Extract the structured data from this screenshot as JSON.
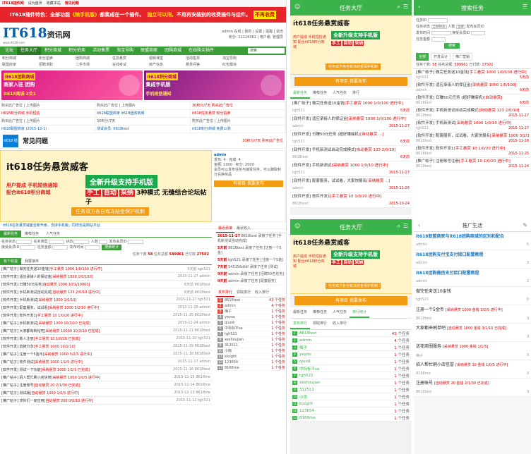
{
  "desktop": {
    "topbar": {
      "brand": "IT618插件网",
      "links": [
        "设为首页",
        "收藏本站",
        "常见问题"
      ]
    },
    "redbar": {
      "text1": "IT618插件特色：全部功能",
      "hl1": "(除手机版)",
      "text2": "都集成在一个插件。",
      "hl2": "独立可以用,",
      "text3": "不用再安装别的收费插件与组件。",
      "tag": "不再收费"
    },
    "logo": {
      "name": "IT618",
      "suffix": "资讯网",
      "url": "www.it618.com"
    },
    "userbox": {
      "line1": "admin 在线 | 我的 | 设置 | 提醒 | 退出",
      "line2": "积分: 11124361 | 用户组: 管理员"
    },
    "nav": [
      "论坛",
      "任务大厅",
      "积分商城",
      "积分拍卖",
      "活动售票",
      "淘宝导购",
      "联盟商家",
      "团购商城",
      "在线购买插件"
    ],
    "nav_active": 1,
    "nav_search": "搜索",
    "subnav": [
      "积分商城",
      "积分拍卖",
      "团购商城",
      "任务悬赏",
      "视频课堂",
      "活动售票",
      "淘宝导购",
      "联盟商家",
      "招聘求职",
      "二手市场",
      "在线考试",
      "房产信息",
      "悬赏问答",
      "红包模块"
    ],
    "banners": [
      {
        "tag": "it618团购商城",
        "title": "商家入驻 团购",
        "sub": "it618商城 2合1"
      },
      {
        "tag": "it618积分商城",
        "title": "集成手机版",
        "sub": "手机短信通知"
      }
    ],
    "adgrid": [
      {
        "text": "购买此广告位 | 上传图片",
        "cls": ""
      },
      {
        "text": "购买此广告位 | 上传图片",
        "cls": ""
      },
      {
        "text": "30积分/7天 购买此广告位",
        "cls": "r"
      },
      {
        "text": "it618积分商城 手机短信",
        "cls": "r"
      },
      {
        "text": "it618联盟商家 it618团购商城",
        "cls": "b"
      },
      {
        "text": "it618任务悬赏 积分拍卖",
        "cls": "r"
      },
      {
        "text": "购买此广告位 | 上传图片",
        "cls": ""
      },
      {
        "text": "30积分/7天",
        "cls": ""
      },
      {
        "text": "购买此广告位 | 上传图片",
        "cls": ""
      },
      {
        "text": "it618联盟商家 (2015-12-1)",
        "cls": "b"
      },
      {
        "text": "测试会员: it618test",
        "cls": "b"
      },
      {
        "text": "it618积分商城 免费公测",
        "cls": "b"
      }
    ],
    "faq": {
      "icon": "it618 插件",
      "title": "常见问题",
      "note": "30积分/7天 购买此广告位"
    },
    "hero": {
      "t1": "it618任务悬赏威客",
      "t2": "全新升级支持手机版",
      "t3a": "手工",
      "t3b": "自动",
      "t3c": "采纳",
      "t3d": "3种模式 无缝结合论坛帖子",
      "t4": "用户提成 手机短信通知 配合it618积分商城",
      "t5": "任务双方各自有冻结金保护机制"
    },
    "profile": {
      "name": "admin",
      "line1": "发布: 4  · 完成: 4",
      "line2": "金额: 1000 · 积分: 2000",
      "line3": "会员可以发布任务与接受任务，可以赚取积分兑换奖品",
      "btn": "有项目 我要发布"
    },
    "ticker": "it618任务悬赏威客全新升级，支持手机版，同样也是网站平台",
    "tabs": [
      "最新任务",
      "推荐任务",
      "人气任务"
    ],
    "filter": {
      "l1": "任务状态",
      "l2": "任务类型",
      "l3": "状态",
      "l4": "人数",
      "l5": "发布会员ID",
      "l6": "接受会员ID",
      "l7": "任务金额",
      "l8": "发布时间",
      "go": "搜索统计"
    },
    "counter": {
      "a": "任务个数",
      "b": "58",
      "c": "任务总额",
      "d": "589961",
      "e": "已付款",
      "f": "27502"
    },
    "tabs2": [
      "有个收益",
      "我要接单"
    ],
    "tasks": [
      {
        "t": "[推广帖子] 做完任务送10金钱",
        "e": "[手工悬赏 1000 1/0/100 进行中]",
        "r": "5天前 tgh521"
      },
      {
        "t": "[软件开发] 适应承接人的保证金",
        "e": "[采纳悬赏 1000 1/0/100]",
        "r": "2015-11-27 admin"
      },
      {
        "t": "[软件开发] 日赚50元任务",
        "e": "[自动悬赏 1000 10/1/10000]",
        "r": "6天前 8618test"
      },
      {
        "t": "[软件开发] 手机新测试自动完成",
        "e": "[自动悬赏 123 2/0/10 进行中]",
        "r": "6天前 8618test"
      },
      {
        "t": "[软件开发] 手机新测试",
        "e": "[采纳悬赏 1000 1/0/10]",
        "r": "2015-11-27 tgh521"
      },
      {
        "t": "[软件开发] 配套服务，试试看",
        "e": "[采纳悬赏 1000 3/2/10 进行中]",
        "r": "2015-11-26 admin"
      },
      {
        "t": "[软件开发] 软件开发1",
        "e": "[手工悬赏 10 1/0/20 进行中]",
        "r": "2015-11-25 8618test"
      },
      {
        "t": "[推广帖子] 手机新测试",
        "e": "[采纳悬赏 1000 10/3/10 已完成]",
        "r": "2015-11-24 admin"
      },
      {
        "t": "[推广帖子] 大家都有新帖吧",
        "e": "[采纳悬赏 10000 10/3/10 已完成]",
        "r": "2015-11-21 8618test"
      },
      {
        "t": "[软件开发] 新人注册",
        "e": "[手工悬赏 10 1/0/20 已完成]",
        "r": "2015-11-20 tgh521"
      },
      {
        "t": "[软件开发] 直链分享",
        "e": "[手工悬赏 1000 10/1/10]",
        "r": "2015-11-19 8618test"
      },
      {
        "t": "[推广帖子] 注册一个5金币",
        "e": "[采纳悬赏 1000 3/2/5 进行中]",
        "r": "2015-11-18 8618test"
      },
      {
        "t": "[推广帖子] 软件测试",
        "e": "[采纳悬赏 1000 1/1/5 进行中]",
        "r": "2015-11-17 admin"
      },
      {
        "t": "[软件开发] 测试一下功能",
        "e": "[采纳悬赏 1000 1/1/1 已完成]",
        "r": "2015-11-16 8618test"
      },
      {
        "t": "[推广帖子] 招人帮忙刷小店信誉",
        "e": "[采纳悬赏 1000 1/0/5 进行中]",
        "r": "2015-11-15 8618me"
      },
      {
        "t": "[推广帖子] 注册账号",
        "e": "[自动悬赏 20 2/1/30 已完成]",
        "r": "2015-11-14 8618me"
      },
      {
        "t": "[推广帖子] 测试版",
        "e": "[自动悬赏 1000 1/0/5 进行中]",
        "r": "2015-11-13 8618me"
      },
      {
        "t": "[推广帖子] 求你们一家应用",
        "e": "[自动悬赏 200 0/0/10 进行中]",
        "r": "2015-11-12 tgh521"
      }
    ],
    "sidebar": {
      "tabs": [
        "最近承接",
        "最近收入"
      ],
      "news": [
        {
          "d": "2015-11-27",
          "t": "8618test 承接了任务 [手机新测试自动完成]"
        },
        {
          "d": "5天前",
          "t": "8618test 承接了任务 [注册一个5金]"
        },
        {
          "d": "5天前",
          "t": "tgh521 承接了任务 [注册一个5金]"
        },
        {
          "d": "7天前",
          "t": "545156dfdf 承接了任务 [测试]"
        },
        {
          "d": "9天前",
          "t": "admin 承接了任务 [招聘50名任务]"
        },
        {
          "d": "9天前",
          "t": "admin 承接了任务 [配套服务]"
        }
      ],
      "rtabs": [
        "发布排行",
        "领取排行",
        "收入排行"
      ],
      "ranks": [
        {
          "n": "1",
          "name": "8618test",
          "c": "43 个任务"
        },
        {
          "n": "2",
          "name": "admin",
          "c": "4 个任务"
        },
        {
          "n": "3",
          "name": "梅子",
          "c": "1 个任务"
        },
        {
          "n": "4",
          "name": "yeyou",
          "c": "1 个任务"
        },
        {
          "n": "5",
          "name": "qiuo9",
          "c": "1 个任务"
        },
        {
          "n": "6",
          "name": "中标标平se",
          "c": "1 个任务"
        },
        {
          "n": "7",
          "name": "tgh521",
          "c": "1 个任务"
        },
        {
          "n": "8",
          "name": "xeshoujian",
          "c": "1 个任务"
        },
        {
          "n": "9",
          "name": "312511",
          "c": "1 个任务"
        },
        {
          "n": "10",
          "name": "小雨",
          "c": "1 个任务"
        },
        {
          "n": "11",
          "name": "kloight",
          "c": "1 个任务"
        },
        {
          "n": "12",
          "name": "123654",
          "c": "1 个任务"
        },
        {
          "n": "13",
          "name": "8168me",
          "c": "1 个任务"
        }
      ]
    }
  },
  "mob1": {
    "title": "任务大厅",
    "btn": "有项目 我要发布",
    "tabs": [
      "最新任务",
      "推荐任务",
      "人气任务",
      "排行"
    ],
    "tasks": [
      {
        "t": "[推广帖子] 做完任务送10金钱",
        "e": "[手工悬赏 1000 1/0/100 进行中]",
        "u": "tgh521",
        "r": "5天前"
      },
      {
        "t": "[软件开发] 适应承接人的保证金",
        "e": "[采纳悬赏 1000 1/0/100 进行中]",
        "u": "admin",
        "r": "2015-11-27"
      },
      {
        "t": "[软件开发] 日赚50元任务 (超好赚接机)",
        "e": "[自动悬赏 ...]",
        "u": "tgh521",
        "r": "6天前"
      },
      {
        "t": "[软件开发] 手机新测试自动完成模式",
        "e": "[自动悬赏 123 2/0/10]",
        "u": "8618test",
        "r": "6天前"
      },
      {
        "t": "[软件开发] 手机新测试",
        "e": "[采纳悬赏 1000 1/0/10 进行中]",
        "u": "tgh521",
        "r": "2015-11-27"
      },
      {
        "t": "[软件开发] 配套服务，试试看，大家快报名",
        "e": "[采纳悬赏 ...]",
        "u": "admin",
        "r": "2015-11-26"
      },
      {
        "t": "[软件开发] 软件开发1",
        "e": "[手工悬赏 10 1/0/20 进行中]",
        "u": "8618test",
        "r": "2015-10-24"
      }
    ]
  },
  "mob3": {
    "title": "任务大厅",
    "btn": "有项目 我要发布",
    "tabs": [
      "最新任务",
      "推荐任务",
      "人气任务",
      "排行统计"
    ],
    "rtabs": [
      "发布排行",
      "领取排行",
      "收入排行"
    ],
    "ranks": [
      {
        "n": "1",
        "name": "8618test",
        "c": "43",
        "u": "个任务"
      },
      {
        "n": "2",
        "name": "admin",
        "c": "4",
        "u": "个任务"
      },
      {
        "n": "3",
        "name": "梅子",
        "c": "1",
        "u": "个任务"
      },
      {
        "n": "4",
        "name": "yeyou",
        "c": "1",
        "u": "个任务"
      },
      {
        "n": "5",
        "name": "qiuo9",
        "c": "1",
        "u": "个任务"
      },
      {
        "n": "6",
        "name": "中标标平se",
        "c": "1",
        "u": "个任务"
      },
      {
        "n": "7",
        "name": "tgh521",
        "c": "1",
        "u": "个任务"
      },
      {
        "n": "8",
        "name": "xeshoujian",
        "c": "1",
        "u": "个任务"
      },
      {
        "n": "9",
        "name": "312511",
        "c": "1",
        "u": "个任务"
      },
      {
        "n": "10",
        "name": "小雨",
        "c": "1",
        "u": "个任务"
      },
      {
        "n": "11",
        "name": "kloight",
        "c": "1",
        "u": "个任务"
      },
      {
        "n": "12",
        "name": "123654",
        "c": "1",
        "u": "个任务"
      },
      {
        "n": "13",
        "name": "8168me",
        "c": "1",
        "u": "个任务"
      }
    ]
  },
  "mob2": {
    "title": "搜索任务",
    "form": {
      "l1": "任务ID",
      "l2": "任务状态",
      "s1": "全部状态",
      "l3": "人数",
      "s2": "全部",
      "l4": "发布会员ID",
      "l5": "发布时间",
      "l6": "接受会员ID",
      "l7": "任务金额",
      "go": "搜索"
    },
    "tabs": [
      "全部",
      "开发设计",
      "推广营销"
    ],
    "count": {
      "a": "任务个数:",
      "b": "58",
      "c": "任务总额:",
      "d": "589961",
      "e": "已付款:",
      "f": "27502"
    },
    "tasks": [
      {
        "t": "[推广帖子] 做完任务送10金钱",
        "e": "[手工悬赏 1000 1/0/100 进行中]",
        "u": "tgh521",
        "r": "5天前"
      },
      {
        "t": "[软件开发] 适应承接人的保证金",
        "e": "[采纳悬赏 1000 1/0/100]",
        "u": "admin",
        "r": "6天前"
      },
      {
        "t": "[软件开发] 日赚50元任务 (超好赚接机)",
        "e": "[自动悬赏]",
        "u": "8618test",
        "r": "6天前"
      },
      {
        "t": "[软件开发] 手机新测试自动完成模式",
        "e": "[自动悬赏 123 2/0/10]",
        "u": "8618test",
        "r": "2015-11-27"
      },
      {
        "t": "[软件开发] 手机新测试",
        "e": "[采纳悬赏 1000 1/0/10 进行中]",
        "u": "tgh521",
        "r": "2015-11-27"
      },
      {
        "t": "[软件开发] 配套服务，试试看，大家快报名",
        "e": "[采纳悬赏 1000 3/2/10]",
        "u": "8618test",
        "r": "2015-11-26"
      },
      {
        "t": "[软件开发] 软件开发1",
        "e": "[手工悬赏 10 1/0/20 进行中]",
        "u": "8618test",
        "r": "2015-11-25"
      },
      {
        "t": "[推广帖子] 注册账号注册",
        "e": "[手工悬赏 10 1/0/20 进行中]",
        "u": "8618test",
        "r": "2015-11-24"
      }
    ]
  },
  "mob4": {
    "title": "推广生活",
    "items": [
      {
        "t": "it618联盟商家与it618团购商城的区别和配合",
        "hot": true,
        "e": "",
        "u": "admin",
        "r": "5"
      },
      {
        "t": "it618团购支付宝支付接口配置教程",
        "hot": true,
        "e": "",
        "u": "admin",
        "r": "3"
      },
      {
        "t": "it618团购微信支付接口配置教程",
        "hot": true,
        "e": "",
        "u": "admin",
        "r": "2"
      },
      {
        "t": "做完任务送10金钱",
        "hot": false,
        "e": "",
        "u": "tgh521",
        "r": "0"
      },
      {
        "t": "注册一个5金币",
        "hot": false,
        "e": "[采纳悬赏 1000 金钱 3/2/5 进行中]",
        "u": "8618test",
        "r": "0"
      },
      {
        "t": "大家都来刷单吧",
        "hot": false,
        "e": "[自动悬赏 1000 金钱 3/1/10 已完成]",
        "u": "",
        "r": "0"
      },
      {
        "t": "送花商圈服务",
        "hot": false,
        "e": "[采纳悬赏 1000 金钱 1/1/5]",
        "u": "梅子",
        "r": "0"
      },
      {
        "t": "招人帮忙刷小店信誉",
        "hot": false,
        "e": "[采纳悬赏 10 金钱 1/0/5 进行中]",
        "u": "8168me",
        "r": "0"
      },
      {
        "t": "注册账号",
        "hot": false,
        "e": "[自动悬赏 20 金钱 2/1/30 已完成]",
        "u": "8618test",
        "r": "0"
      }
    ]
  }
}
